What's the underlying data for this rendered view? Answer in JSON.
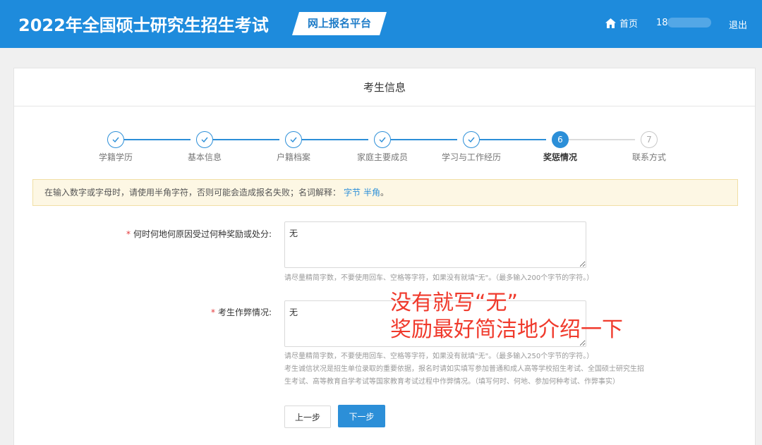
{
  "header": {
    "title": "2022年全国硕士研究生招生考试",
    "platform": "网上报名平台",
    "home_label": "首页",
    "user_prefix": "18",
    "logout_label": "退出",
    "bg_color": "#1e8bdc"
  },
  "panel": {
    "title": "考生信息"
  },
  "steps": [
    {
      "label": "学籍学历",
      "status": "done"
    },
    {
      "label": "基本信息",
      "status": "done"
    },
    {
      "label": "户籍档案",
      "status": "done"
    },
    {
      "label": "家庭主要成员",
      "status": "done"
    },
    {
      "label": "学习与工作经历",
      "status": "done"
    },
    {
      "label": "奖惩情况",
      "status": "active",
      "number": "6"
    },
    {
      "label": "联系方式",
      "status": "todo",
      "number": "7"
    }
  ],
  "notice": {
    "text": "在输入数字或字母时，请使用半角字符，否则可能会造成报名失败；名词解释：",
    "link1": "字节",
    "link2": "半角",
    "end": "。"
  },
  "form": {
    "rewards": {
      "required_mark": "*",
      "label": "何时何地何原因受过何种奖励或处分:",
      "value": "无",
      "hint": "请尽量精简字数，不要使用回车、空格等字符，如果没有就填\"无\"。（最多输入200个字节的字符。）"
    },
    "cheating": {
      "required_mark": "*",
      "label": "考生作弊情况:",
      "value": "无",
      "hint1": "请尽量精简字数，不要使用回车、空格等字符，如果没有就填\"无\"。（最多输入250个字节的字符。）",
      "hint2": "考生诚信状况是招生单位录取的重要依据，报名时请如实填写参加普通和成人高等学校招生考试、全国硕士研究生招",
      "hint3": "生考试、高等教育自学考试等国家教育考试过程中作弊情况。（填写何时、何地、参加何种考试、作弊事实）"
    }
  },
  "buttons": {
    "prev": "上一步",
    "next": "下一步"
  },
  "annotation": {
    "line1": "没有就写“无”",
    "line2": "奖励最好简洁地介绍一下"
  }
}
